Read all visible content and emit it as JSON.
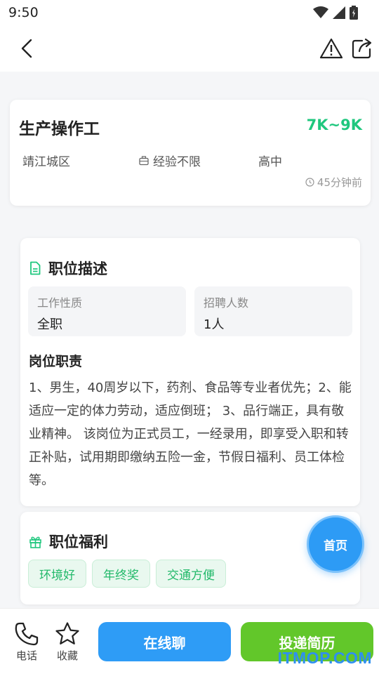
{
  "status_bar": {
    "time": "9:50",
    "icons": [
      "wifi-icon",
      "signal-icon",
      "battery-icon"
    ]
  },
  "nav": {
    "icons": [
      "back-icon",
      "report-icon",
      "share-icon"
    ]
  },
  "job": {
    "title": "生产操作工",
    "salary": "7K~9K",
    "location": "靖江城区",
    "experience": "经验不限",
    "education": "高中",
    "posted": "45分钟前"
  },
  "description": {
    "section_title": "职位描述",
    "work_type_label": "工作性质",
    "work_type_value": "全职",
    "headcount_label": "招聘人数",
    "headcount_value": "1人",
    "duty_title": "岗位职责",
    "duty_text": "1、男生，40周岁以下，药剂、食品等专业者优先；2、能适应一定的体力劳动，适应倒班； 3、品行端正，具有敬业精神。 该岗位为正式员工，一经录用，即享受入职和转正补贴，试用期即缴纳五险一金，节假日福利、员工体检等。"
  },
  "benefits": {
    "section_title": "职位福利",
    "tags": [
      "环境好",
      "年终奖",
      "交通方便"
    ]
  },
  "fab": {
    "label": "首页"
  },
  "bottom_bar": {
    "phone_label": "电话",
    "favorite_label": "收藏",
    "chat_label": "在线聊",
    "apply_label": "投递简历"
  },
  "watermark": "ITMOP.COM",
  "colors": {
    "salary": "#1fc77e",
    "chat": "#2e9cf6",
    "apply": "#62c72a",
    "tag_text": "#22b96a"
  }
}
